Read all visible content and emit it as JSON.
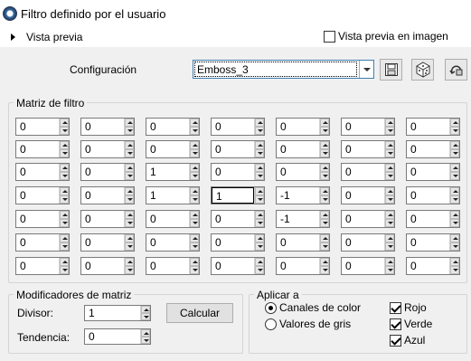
{
  "window": {
    "title": "Filtro definido por el usuario",
    "icon": "app-icon"
  },
  "preview": {
    "toggle_label": "Vista previa",
    "image_preview_label": "Vista previa en imagen",
    "image_preview_checked": false
  },
  "config": {
    "label": "Configuración",
    "selected": "Emboss_3",
    "buttons": [
      "save-preset-icon",
      "randomize-icon",
      "reset-icon"
    ]
  },
  "matrix": {
    "title": "Matriz de filtro",
    "rows": [
      [
        "0",
        "0",
        "0",
        "0",
        "0",
        "0",
        "0"
      ],
      [
        "0",
        "0",
        "0",
        "0",
        "0",
        "0",
        "0"
      ],
      [
        "0",
        "0",
        "1",
        "0",
        "0",
        "0",
        "0"
      ],
      [
        "0",
        "0",
        "1",
        "1",
        "-1",
        "0",
        "0"
      ],
      [
        "0",
        "0",
        "0",
        "0",
        "-1",
        "0",
        "0"
      ],
      [
        "0",
        "0",
        "0",
        "0",
        "0",
        "0",
        "0"
      ],
      [
        "0",
        "0",
        "0",
        "0",
        "0",
        "0",
        "0"
      ]
    ]
  },
  "modifiers": {
    "title": "Modificadores de matriz",
    "divisor_label": "Divisor:",
    "divisor_value": "1",
    "bias_label": "Tendencia:",
    "bias_value": "0",
    "calc_label": "Calcular"
  },
  "apply": {
    "title": "Aplicar a",
    "color_channels_label": "Canales de color",
    "gray_values_label": "Valores de gris",
    "mode": "color",
    "red_label": "Rojo",
    "green_label": "Verde",
    "blue_label": "Azul",
    "red": true,
    "green": true,
    "blue": true
  }
}
